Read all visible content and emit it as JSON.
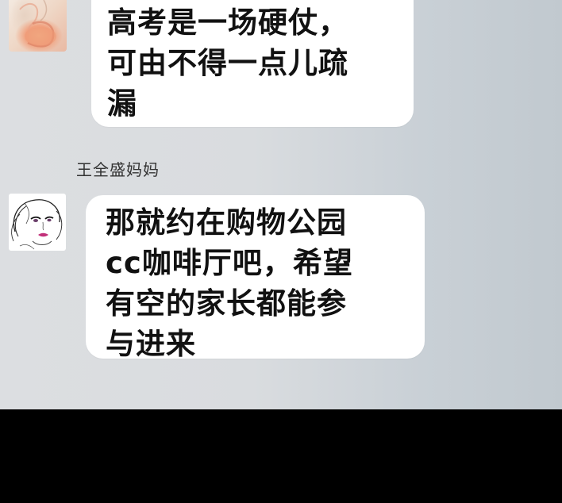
{
  "messages": [
    {
      "sender_name": "",
      "avatar_icon": "floral-illustration-avatar",
      "lines": [
        "高考是一场硬仗，",
        "可由不得一点儿疏",
        "漏"
      ]
    },
    {
      "sender_name": "王全盛妈妈",
      "avatar_icon": "sketch-woman-face-avatar",
      "lines": [
        "那就约在购物公园",
        "cc咖啡厅吧，希望",
        "有空的家长都能参",
        "与进来"
      ]
    }
  ],
  "colors": {
    "chat_background": "#d9dcdf",
    "bubble": "#ffffff",
    "text": "#111111",
    "bottom_band": "#000000"
  }
}
